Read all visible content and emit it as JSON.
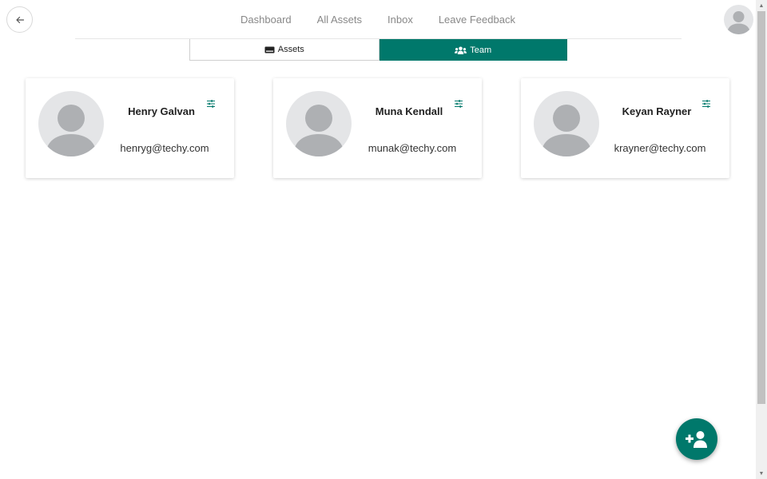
{
  "nav": {
    "links": [
      "Dashboard",
      "All Assets",
      "Inbox",
      "Leave Feedback"
    ]
  },
  "tabs": {
    "assets_label": "Assets",
    "team_label": "Team",
    "active": "Team"
  },
  "team": [
    {
      "name": "Henry Galvan",
      "email": "henryg@techy.com"
    },
    {
      "name": "Muna Kendall",
      "email": "munak@techy.com"
    },
    {
      "name": "Keyan Rayner",
      "email": "krayner@techy.com"
    }
  ],
  "icons": {
    "back": "arrow-left-icon",
    "user_avatar": "user-avatar-icon",
    "assets_tab": "id-card-icon",
    "team_tab": "users-icon",
    "card_settings": "sliders-icon",
    "fab": "user-plus-icon"
  },
  "colors": {
    "accent": "#00786b",
    "avatar_bg": "#e4e5e7",
    "avatar_fg": "#aeb0b3",
    "nav_text": "#888888"
  }
}
